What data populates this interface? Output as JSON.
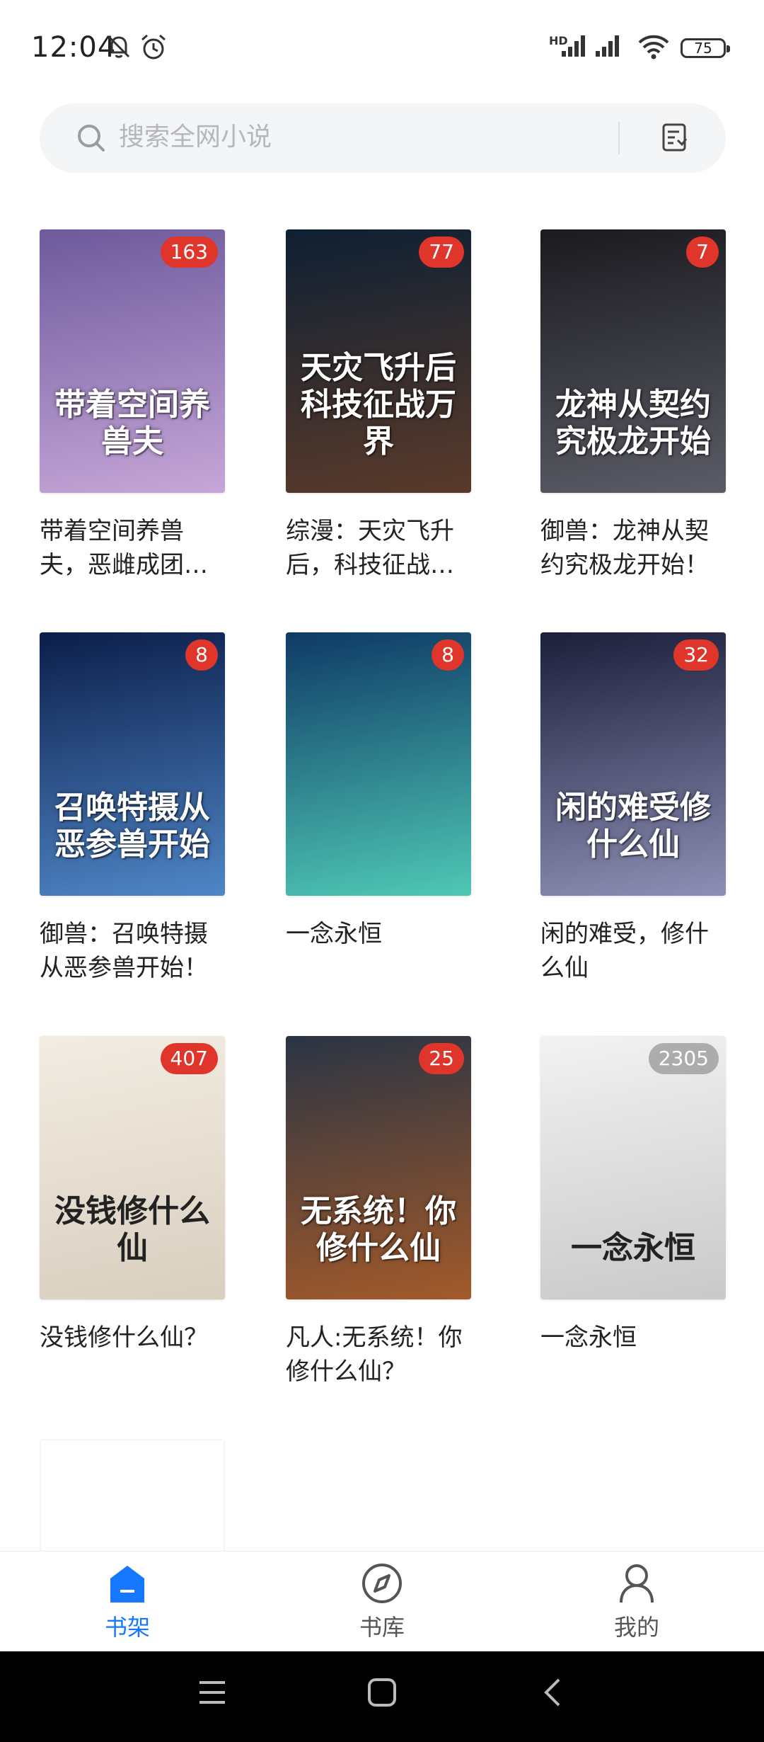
{
  "status_bar": {
    "time": "12:04",
    "network_label": "HD",
    "battery": "75",
    "icons": [
      "bell-off-icon",
      "alarm-icon",
      "signal-icon",
      "signal-icon",
      "wifi-icon",
      "battery-icon"
    ]
  },
  "search": {
    "placeholder": "搜索全网小说",
    "icon": "search-icon",
    "action_icon": "shelf-manage-icon"
  },
  "books": [
    {
      "title": "带着空间养兽夫，恶雌成团宠了",
      "cover_text": "带着空间养兽夫",
      "badge": "163",
      "cover_colors": [
        "#6d5a9c",
        "#c6a6d8"
      ]
    },
    {
      "title": "综漫：天灾飞升后，科技征战万界",
      "cover_text": "天灾飞升后科技征战万界",
      "badge": "77",
      "cover_colors": [
        "#0e2033",
        "#5a3a2a"
      ]
    },
    {
      "title": "御兽：龙神从契约究极龙开始！",
      "cover_text": "龙神从契约究极龙开始",
      "badge": "7",
      "cover_colors": [
        "#1a1a1f",
        "#5b5c66"
      ]
    },
    {
      "title": "御兽：召唤特摄从恶参兽开始！",
      "cover_text": "召唤特摄从恶参兽开始",
      "badge": "8",
      "cover_colors": [
        "#0b1e4a",
        "#4f86c7"
      ]
    },
    {
      "title": "一念永恒",
      "cover_text": "",
      "badge": "8",
      "cover_colors": [
        "#0e3a66",
        "#4fc8b5"
      ]
    },
    {
      "title": "闲的难受，修什么仙",
      "cover_text": "闲的难受修什么仙",
      "badge": "32",
      "cover_colors": [
        "#1b1f3a",
        "#8d8fb5"
      ]
    },
    {
      "title": "没钱修什么仙？",
      "cover_text": "没钱修什么仙",
      "badge": "407",
      "cover_colors": [
        "#f3ece2",
        "#d9cfc0"
      ]
    },
    {
      "title": "凡人:无系统！你修什么仙？",
      "cover_text": "无系统！你修什么仙",
      "badge": "25",
      "cover_colors": [
        "#2a3444",
        "#a35a2a"
      ]
    },
    {
      "title": "一念永恒",
      "cover_text": "一念永恒",
      "badge": "2305",
      "cover_colors": [
        "#f2f2f2",
        "#c9c9c9"
      ]
    }
  ],
  "bottom_nav": [
    {
      "label": "书架",
      "icon": "bookshelf-icon",
      "active": true
    },
    {
      "label": "书库",
      "icon": "compass-icon",
      "active": false
    },
    {
      "label": "我的",
      "icon": "user-icon",
      "active": false
    }
  ],
  "system_nav": [
    "menu-icon",
    "home-icon",
    "back-icon"
  ],
  "colors": {
    "accent": "#1677ff",
    "badge": "#e0352b"
  }
}
